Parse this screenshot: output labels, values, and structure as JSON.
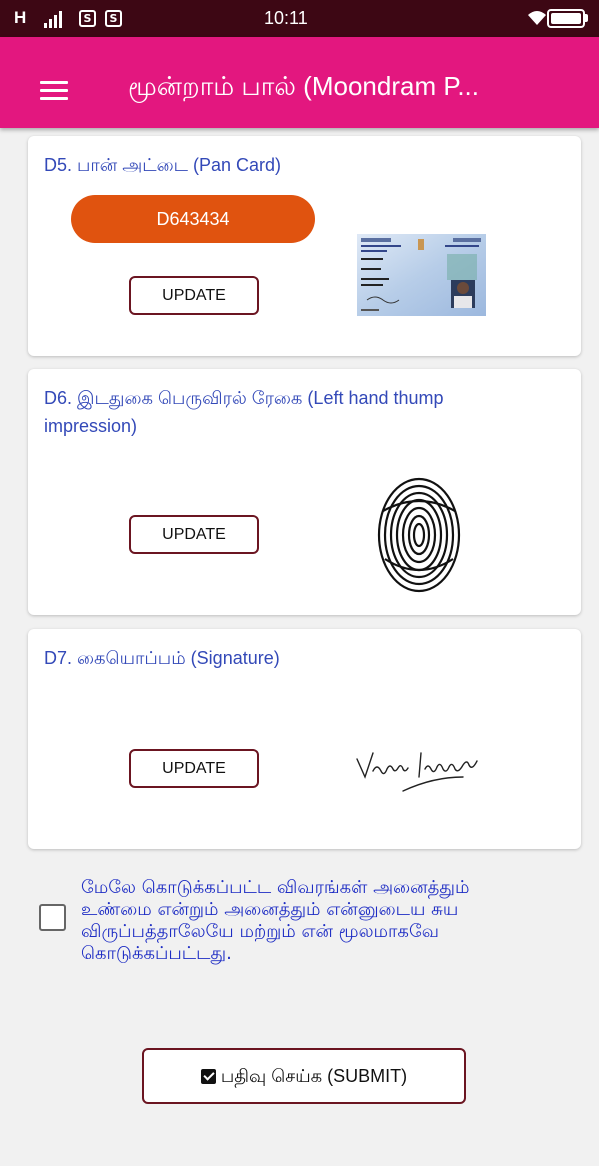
{
  "status_bar": {
    "signal": "H",
    "time": "10:11",
    "notif_1": "S",
    "notif_2": "S"
  },
  "app_bar": {
    "title": "மூன்றாம் பால் (Moondram P..."
  },
  "cards": {
    "d5": {
      "title": "D5. பான் அட்டை (Pan Card)",
      "pan_number": "D643434",
      "update_label": "UPDATE"
    },
    "d6": {
      "title_line1": "D6. இடதுகை பெருவிரல் ரேகை (Left hand thump",
      "title_line2": "impression)",
      "update_label": "UPDATE"
    },
    "d7": {
      "title": "D7. கையொப்பம் (Signature)",
      "update_label": "UPDATE"
    }
  },
  "consent": {
    "line1": "மேலே கொடுக்கப்பட்ட விவரங்கள் அனைத்தும்",
    "line2": "உண்மை என்றும் அனைத்தும் என்னுடைய சுய",
    "line3": "விருப்பத்தாலேயே மற்றும் என் மூலமாகவே",
    "line4": "கொடுக்கப்பட்டது.",
    "checked": false
  },
  "submit": {
    "label": "பதிவு செய்க (SUBMIT)"
  },
  "colors": {
    "status_bar": "#3d0714",
    "app_bar": "#e3177f",
    "pan_pill": "#e0530f",
    "card_title": "#3349b8",
    "consent_text": "#1e2dc4",
    "button_border": "#6b1521"
  },
  "icons": {
    "menu": "hamburger-menu-icon",
    "submit": "checkbox-checked-icon"
  }
}
